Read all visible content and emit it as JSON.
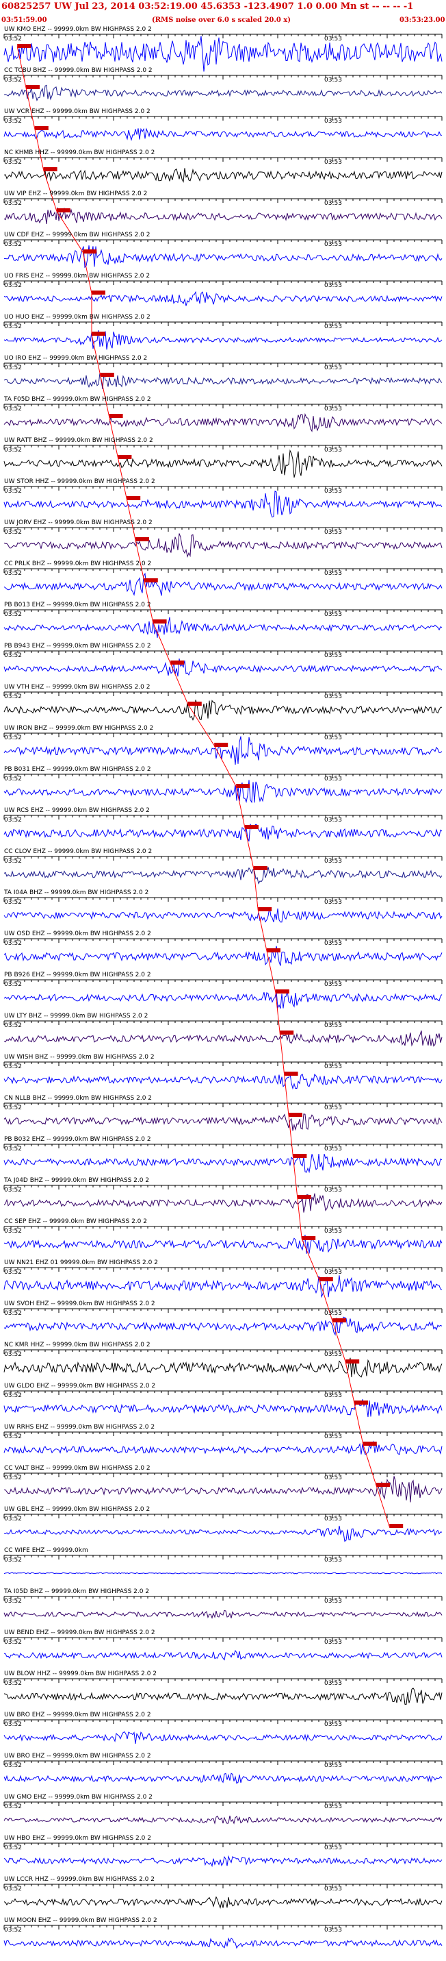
{
  "header": {
    "title": "60825257 UW Jul 23, 2014 03:52:19.00   45.6353 -123.4907  1.0 0.00 Mn st -- -- -- -1",
    "start_time": "03:51:59.00",
    "note": "(RMS noise over 6.0 s scaled 20.0 x)",
    "end_time": "03:53:23.00"
  },
  "tick_labels": {
    "left": "03:52",
    "right": "03:53"
  },
  "colors": {
    "blue": "#0000ff",
    "navy": "#1a1a8c",
    "indigo": "#330066",
    "black": "#000000",
    "pick": "#ff0000",
    "pick_box": "#cc0000"
  },
  "rows": [
    {
      "label": "UW KMO EHZ -- 99999.0km BW  HIGHPASS  2.0  2",
      "color": "blue",
      "pick": 0.03,
      "amp": 0.9,
      "burst": 0.45,
      "burst_amp": 1.0
    },
    {
      "label": "CC TCBU BHZ -- 99999.0km BW  HIGHPASS  2.0  2",
      "color": "navy",
      "pick": 0.05,
      "amp": 0.25,
      "burst": 0.1,
      "burst_amp": 0.4
    },
    {
      "label": "UW VCR EHZ -- 99999.0km BW  HIGHPASS  2.0  2",
      "color": "blue",
      "pick": 0.07,
      "amp": 0.25,
      "burst": 0.3,
      "burst_amp": 0.3
    },
    {
      "label": "NC KHMB HHZ -- 99999.0km BW  HIGHPASS  2.0  2",
      "color": "black",
      "pick": 0.09,
      "amp": 0.35,
      "burst": 0.4,
      "burst_amp": 0.4
    },
    {
      "label": "UW VIP EHZ -- 99999.0km BW  HIGHPASS  2.0  2",
      "color": "indigo",
      "pick": 0.12,
      "amp": 0.3,
      "burst": 0.12,
      "burst_amp": 0.6
    },
    {
      "label": "UW CDF EHZ -- 99999.0km BW  HIGHPASS  2.0  2",
      "color": "blue",
      "pick": 0.18,
      "amp": 0.3,
      "burst": 0.2,
      "burst_amp": 0.7
    },
    {
      "label": "UO FRIS EHZ -- 99999.0km BW  HIGHPASS  2.0  2",
      "color": "blue",
      "pick": 0.2,
      "amp": 0.25,
      "burst": 0.44,
      "burst_amp": 0.5
    },
    {
      "label": "UO HUO EHZ -- 99999.0km BW  HIGHPASS  2.0  2",
      "color": "blue",
      "pick": 0.2,
      "amp": 0.2,
      "burst": 0.22,
      "burst_amp": 0.7
    },
    {
      "label": "UO IRO EHZ -- 99999.0km BW  HIGHPASS  2.0  2",
      "color": "navy",
      "pick": 0.22,
      "amp": 0.25,
      "burst": 0.22,
      "burst_amp": 0.5
    },
    {
      "label": "TA F05D BHZ -- 99999.0km BW  HIGHPASS  2.0  2",
      "color": "indigo",
      "pick": 0.24,
      "amp": 0.3,
      "burst": 0.7,
      "burst_amp": 0.7
    },
    {
      "label": "UW RATT BHZ -- 99999.0km BW  HIGHPASS  2.0  2",
      "color": "black",
      "pick": 0.26,
      "amp": 0.3,
      "burst": 0.66,
      "burst_amp": 1.0
    },
    {
      "label": "UW STOR HHZ -- 99999.0km BW  HIGHPASS  2.0  2",
      "color": "blue",
      "pick": 0.28,
      "amp": 0.3,
      "burst": 0.62,
      "burst_amp": 1.0
    },
    {
      "label": "UW JORV EHZ -- 99999.0km BW  HIGHPASS  2.0  2",
      "color": "indigo",
      "pick": 0.3,
      "amp": 0.3,
      "burst": 0.4,
      "burst_amp": 1.0
    },
    {
      "label": "CC PRLK BHZ -- 99999.0km BW  HIGHPASS  2.0  2",
      "color": "blue",
      "pick": 0.32,
      "amp": 0.3,
      "burst": 0.33,
      "burst_amp": 0.8
    },
    {
      "label": "PB B013 EHZ -- 99999.0km BW  HIGHPASS  2.0  2",
      "color": "blue",
      "pick": 0.34,
      "amp": 0.25,
      "burst": 0.36,
      "burst_amp": 0.8
    },
    {
      "label": "PB B943 EHZ -- 99999.0km BW  HIGHPASS  2.0  2",
      "color": "blue",
      "pick": 0.38,
      "amp": 0.25,
      "burst": 0.4,
      "burst_amp": 0.6
    },
    {
      "label": "UW VTH EHZ -- 99999.0km BW  HIGHPASS  2.0  2",
      "color": "black",
      "pick": 0.42,
      "amp": 0.3,
      "burst": 0.45,
      "burst_amp": 0.6
    },
    {
      "label": "UW IRON BHZ -- 99999.0km BW  HIGHPASS  2.0  2",
      "color": "blue",
      "pick": 0.48,
      "amp": 0.35,
      "burst": 0.54,
      "burst_amp": 1.0
    },
    {
      "label": "PB B031 EHZ -- 99999.0km BW  HIGHPASS  2.0  2",
      "color": "blue",
      "pick": 0.53,
      "amp": 0.3,
      "burst": 0.56,
      "burst_amp": 0.7
    },
    {
      "label": "UW RCS EHZ -- 99999.0km BW  HIGHPASS  2.0  2",
      "color": "blue",
      "pick": 0.55,
      "amp": 0.35,
      "burst": 0.57,
      "burst_amp": 0.5
    },
    {
      "label": "CC CLOV EHZ -- 99999.0km BW  HIGHPASS  2.0  2",
      "color": "navy",
      "pick": 0.57,
      "amp": 0.3,
      "burst": 0.58,
      "burst_amp": 0.5
    },
    {
      "label": "TA I04A BHZ -- 99999.0km BW  HIGHPASS  2.0  2",
      "color": "blue",
      "pick": 0.58,
      "amp": 0.3,
      "burst": 0.6,
      "burst_amp": 0.4
    },
    {
      "label": "UW OSD EHZ -- 99999.0km BW  HIGHPASS  2.0  2",
      "color": "blue",
      "pick": 0.6,
      "amp": 0.35,
      "burst": 0.62,
      "burst_amp": 0.5
    },
    {
      "label": "PB B926 EHZ -- 99999.0km BW  HIGHPASS  2.0  2",
      "color": "blue",
      "pick": 0.62,
      "amp": 0.3,
      "burst": 0.64,
      "burst_amp": 0.6
    },
    {
      "label": "UW LTY BHZ -- 99999.0km BW  HIGHPASS  2.0  2",
      "color": "indigo",
      "pick": 0.63,
      "amp": 0.3,
      "burst": 0.95,
      "burst_amp": 0.6
    },
    {
      "label": "UW WISH BHZ -- 99999.0km BW  HIGHPASS  2.0  2",
      "color": "blue",
      "pick": 0.64,
      "amp": 0.3,
      "burst": 0.66,
      "burst_amp": 0.4
    },
    {
      "label": "CN NLLB BHZ -- 99999.0km BW  HIGHPASS  2.0  2",
      "color": "indigo",
      "pick": 0.65,
      "amp": 0.3,
      "burst": 0.67,
      "burst_amp": 0.5
    },
    {
      "label": "PB B032 EHZ -- 99999.0km BW  HIGHPASS  2.0  2",
      "color": "blue",
      "pick": 0.66,
      "amp": 0.3,
      "burst": 0.7,
      "burst_amp": 0.6
    },
    {
      "label": "TA J04D BHZ -- 99999.0km BW  HIGHPASS  2.0  2",
      "color": "indigo",
      "pick": 0.67,
      "amp": 0.3,
      "burst": 0.7,
      "burst_amp": 0.5
    },
    {
      "label": "CC SEP EHZ -- 99999.0km BW  HIGHPASS  2.0  2",
      "color": "blue",
      "pick": 0.68,
      "amp": 0.35,
      "burst": 0.7,
      "burst_amp": 0.5
    },
    {
      "label": "UW NN21 EHZ 01 99999.0km BW  HIGHPASS  2.0  2",
      "color": "blue",
      "pick": 0.72,
      "amp": 0.45,
      "burst": 0.74,
      "burst_amp": 0.6
    },
    {
      "label": "UW SVOH EHZ -- 99999.0km BW  HIGHPASS  2.0  2",
      "color": "blue",
      "pick": 0.75,
      "amp": 0.35,
      "burst": 0.77,
      "burst_amp": 0.4
    },
    {
      "label": "NC KMR HHZ -- 99999.0km BW  HIGHPASS  2.0  2",
      "color": "black",
      "pick": 0.78,
      "amp": 0.45,
      "burst": 0.8,
      "burst_amp": 0.4
    },
    {
      "label": "UW GLDO EHZ -- 99999.0km BW  HIGHPASS  2.0  2",
      "color": "blue",
      "pick": 0.8,
      "amp": 0.35,
      "burst": 0.82,
      "burst_amp": 0.4
    },
    {
      "label": "UW RRHS EHZ -- 99999.0km BW  HIGHPASS  2.0  2",
      "color": "blue",
      "pick": 0.82,
      "amp": 0.3,
      "burst": 0.84,
      "burst_amp": 0.4
    },
    {
      "label": "CC VALT BHZ -- 99999.0km BW  HIGHPASS  2.0  2",
      "color": "indigo",
      "pick": 0.85,
      "amp": 0.3,
      "burst": 0.9,
      "burst_amp": 1.0
    },
    {
      "label": "UW GBL EHZ -- 99999.0km BW  HIGHPASS  2.0  2",
      "color": "blue",
      "pick": 0.88,
      "amp": 0.2,
      "burst": 0.78,
      "burst_amp": 0.7
    },
    {
      "label": "CC WIFE EHZ -- 99999.0km",
      "color": "blue",
      "pick": -1,
      "amp": 0.05,
      "burst": 0.5,
      "burst_amp": 0.0
    },
    {
      "label": "TA I05D BHZ -- 99999.0km BW  HIGHPASS  2.0  2",
      "color": "indigo",
      "pick": -1,
      "amp": 0.2,
      "burst": 0.5,
      "burst_amp": 0.2
    },
    {
      "label": "UW BEND EHZ -- 99999.0km BW  HIGHPASS  2.0  2",
      "color": "blue",
      "pick": -1,
      "amp": 0.25,
      "burst": 0.5,
      "burst_amp": 0.3
    },
    {
      "label": "UW BLOW HHZ -- 99999.0km BW  HIGHPASS  2.0  2",
      "color": "black",
      "pick": -1,
      "amp": 0.3,
      "burst": 0.93,
      "burst_amp": 0.6
    },
    {
      "label": "UW BRO EHZ -- 99999.0km BW  HIGHPASS  2.0  2",
      "color": "blue",
      "pick": -1,
      "amp": 0.25,
      "burst": 0.3,
      "burst_amp": 0.4
    },
    {
      "label": "UW BRO EHZ -- 99999.0km BW  HIGHPASS  2.0  2",
      "color": "blue",
      "pick": -1,
      "amp": 0.25,
      "burst": 0.5,
      "burst_amp": 0.3
    },
    {
      "label": "UW GMO EHZ -- 99999.0km BW  HIGHPASS  2.0  2",
      "color": "indigo",
      "pick": -1,
      "amp": 0.2,
      "burst": 0.5,
      "burst_amp": 0.2
    },
    {
      "label": "UW HBO EHZ -- 99999.0km BW  HIGHPASS  2.0  2",
      "color": "blue",
      "pick": -1,
      "amp": 0.25,
      "burst": 0.5,
      "burst_amp": 0.3
    },
    {
      "label": "UW LCCR HHZ -- 99999.0km BW  HIGHPASS  2.0  2",
      "color": "black",
      "pick": -1,
      "amp": 0.3,
      "burst": 0.5,
      "burst_amp": 0.3
    },
    {
      "label": "UW MOON EHZ -- 99999.0km BW  HIGHPASS  2.0  2",
      "color": "blue",
      "pick": -1,
      "amp": 0.25,
      "burst": 0.5,
      "burst_amp": 0.3
    }
  ]
}
